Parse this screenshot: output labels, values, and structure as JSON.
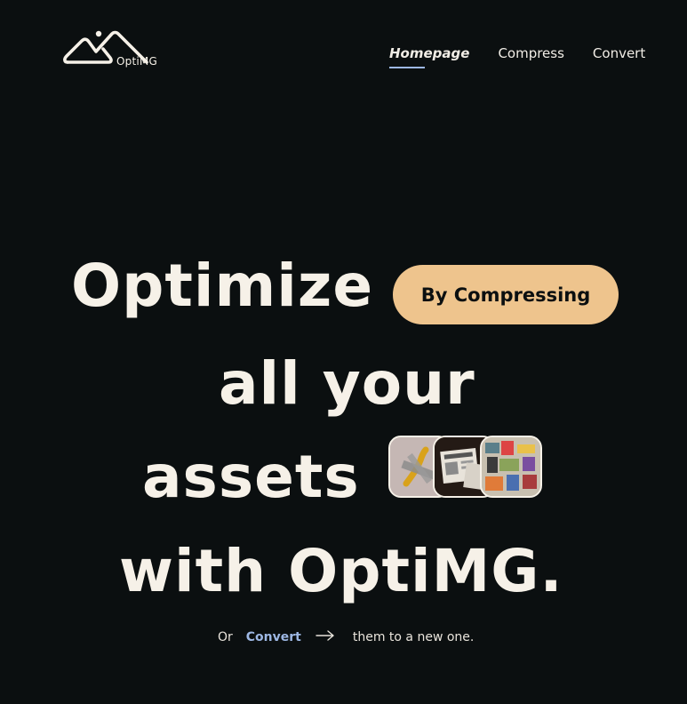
{
  "header": {
    "logo_text": "OptiMG",
    "nav": [
      {
        "label": "Homepage",
        "active": true
      },
      {
        "label": "Compress",
        "active": false
      },
      {
        "label": "Convert",
        "active": false
      }
    ]
  },
  "hero": {
    "line1": "Optimize",
    "pill_label": "By Compressing",
    "line2": "all your",
    "line3": "assets",
    "line4": "with OptiMG."
  },
  "subline": {
    "prefix": "Or",
    "link": "Convert",
    "suffix": "them to a new one."
  },
  "thumbnails": [
    {
      "icon": "banana-taped-image"
    },
    {
      "icon": "newspaper-image"
    },
    {
      "icon": "collage-image"
    }
  ],
  "colors": {
    "background": "#0b0f10",
    "text": "#f6f1e8",
    "accent": "#eec48d",
    "link": "#9db7e3"
  }
}
